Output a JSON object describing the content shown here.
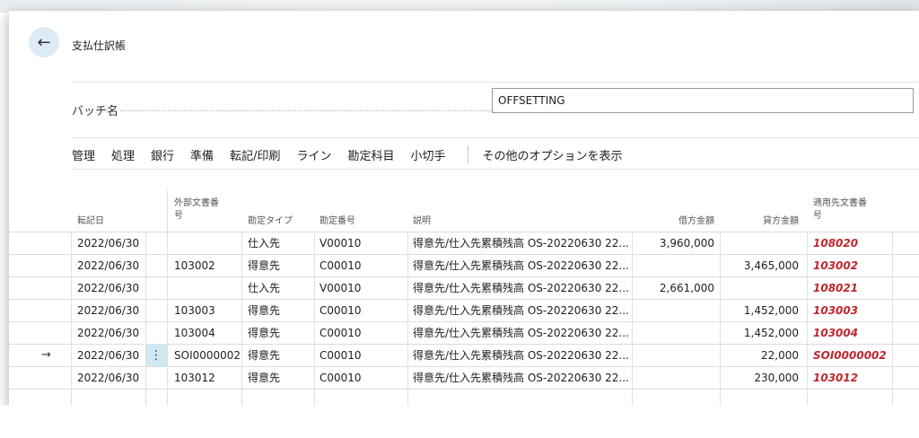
{
  "page": {
    "title": "支払仕訳帳",
    "back_icon": "←"
  },
  "batch": {
    "label": "バッチ名",
    "value": "OFFSETTING"
  },
  "menu": {
    "items": [
      "管理",
      "処理",
      "銀行",
      "準備",
      "転記/印刷",
      "ライン",
      "勘定科目",
      "小切手"
    ],
    "more": "その他のオプションを表示"
  },
  "columns": {
    "posting_date": "転記日",
    "ext_doc_no_1": "外部文書番",
    "ext_doc_no_2": "号",
    "account_type": "勘定タイプ",
    "account_no": "勘定番号",
    "description": "説明",
    "debit": "借方金額",
    "credit": "貸方金額",
    "applies_to_1": "適用先文書番",
    "applies_to_2": "号"
  },
  "rows": [
    {
      "date": "2022/06/30",
      "ext": "",
      "type": "仕入先",
      "account": "V00010",
      "desc": "得意先/仕入先累積残高 OS-20220630 22...",
      "debit": "3,960,000",
      "credit": "",
      "applies": "108020"
    },
    {
      "date": "2022/06/30",
      "ext": "103002",
      "type": "得意先",
      "account": "C00010",
      "desc": "得意先/仕入先累積残高 OS-20220630 22...",
      "debit": "",
      "credit": "3,465,000",
      "applies": "103002"
    },
    {
      "date": "2022/06/30",
      "ext": "",
      "type": "仕入先",
      "account": "V00010",
      "desc": "得意先/仕入先累積残高 OS-20220630 22...",
      "debit": "2,661,000",
      "credit": "",
      "applies": "108021"
    },
    {
      "date": "2022/06/30",
      "ext": "103003",
      "type": "得意先",
      "account": "C00010",
      "desc": "得意先/仕入先累積残高 OS-20220630 22...",
      "debit": "",
      "credit": "1,452,000",
      "applies": "103003"
    },
    {
      "date": "2022/06/30",
      "ext": "103004",
      "type": "得意先",
      "account": "C00010",
      "desc": "得意先/仕入先累積残高 OS-20220630 22...",
      "debit": "",
      "credit": "1,452,000",
      "applies": "103004"
    },
    {
      "date": "2022/06/30",
      "ext": "SOI0000002",
      "type": "得意先",
      "account": "C00010",
      "desc": "得意先/仕入先累積残高 OS-20220630 22...",
      "debit": "",
      "credit": "22,000",
      "applies": "SOI0000002"
    },
    {
      "date": "2022/06/30",
      "ext": "103012",
      "type": "得意先",
      "account": "C00010",
      "desc": "得意先/仕入先累積残高 OS-20220630 22...",
      "debit": "",
      "credit": "230,000",
      "applies": "103012"
    }
  ],
  "active_row_marker": "→",
  "row_menu_icon": "⋮"
}
